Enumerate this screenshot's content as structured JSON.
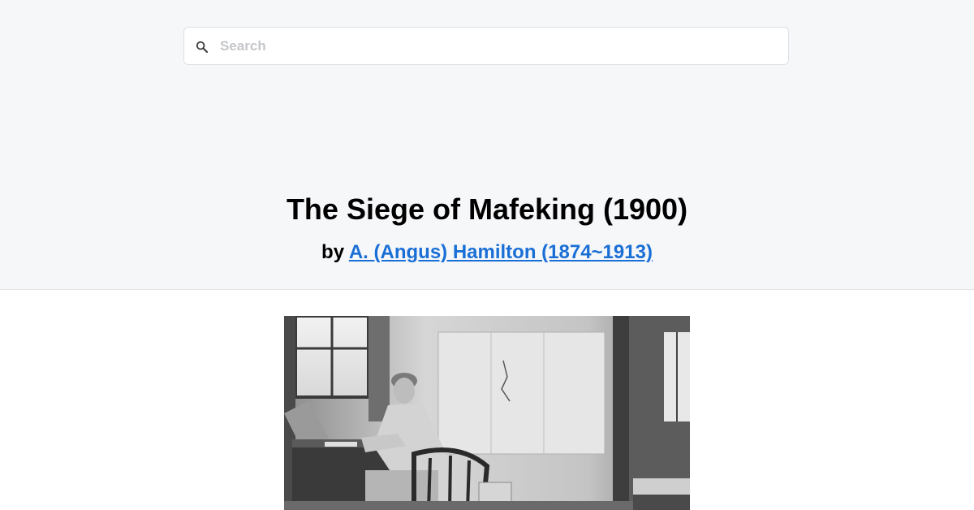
{
  "search": {
    "placeholder": "Search",
    "icon": "search-icon"
  },
  "book": {
    "title": "The Siege of Mafeking (1900)",
    "by_label": "by",
    "author": "A. (Angus) Hamilton (1874~1913)"
  },
  "colors": {
    "header_bg": "#f6f7f9",
    "link": "#1a6fd6",
    "title": "#000000"
  }
}
